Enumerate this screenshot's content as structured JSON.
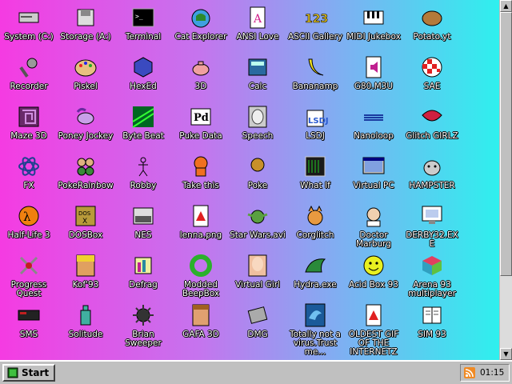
{
  "desktop": {
    "icons": [
      {
        "label": "System (C:)",
        "icon": "computer-icon"
      },
      {
        "label": "Storage (A:)",
        "icon": "floppy-drive-icon"
      },
      {
        "label": "Terminal",
        "icon": "terminal-icon"
      },
      {
        "label": "Cat Explorer",
        "icon": "cat-globe-icon"
      },
      {
        "label": "ANSI Love",
        "icon": "ansi-document-icon"
      },
      {
        "label": "ASCII Gallery",
        "icon": "ascii-numbers-icon"
      },
      {
        "label": "MIDI Jukebox",
        "icon": "piano-keys-icon"
      },
      {
        "label": "Potato.yt",
        "icon": "potato-icon"
      },
      {
        "label": "Recorder",
        "icon": "microphone-icon"
      },
      {
        "label": "Piskel",
        "icon": "palette-icon"
      },
      {
        "label": "HexEd",
        "icon": "hex-cube-icon"
      },
      {
        "label": "3D",
        "icon": "teapot-icon"
      },
      {
        "label": "Calc",
        "icon": "calculator-icon"
      },
      {
        "label": "Bananamp",
        "icon": "banana-icon"
      },
      {
        "label": "G80.M3U",
        "icon": "audio-file-icon"
      },
      {
        "label": "SAE",
        "icon": "checkered-ball-icon"
      },
      {
        "label": "Maze 3D",
        "icon": "maze-icon"
      },
      {
        "label": "Poney Jockey",
        "icon": "pony-icon"
      },
      {
        "label": "Byte Beat",
        "icon": "waveform-icon"
      },
      {
        "label": "Puke Data",
        "icon": "pd-patch-icon"
      },
      {
        "label": "Speech",
        "icon": "face-speech-icon"
      },
      {
        "label": "LSDJ",
        "icon": "lsdj-icon"
      },
      {
        "label": "Nanoloop",
        "icon": "nanoloop-icon"
      },
      {
        "label": "Glitch GIRLZ",
        "icon": "lips-icon"
      },
      {
        "label": "FX",
        "icon": "atom-icon"
      },
      {
        "label": "PokeRainbow",
        "icon": "sprites-icon"
      },
      {
        "label": "Robby",
        "icon": "stick-figure-icon"
      },
      {
        "label": "Take this",
        "icon": "character-icon"
      },
      {
        "label": "Poke",
        "icon": "poke-icon"
      },
      {
        "label": "What If",
        "icon": "terminal-window-icon"
      },
      {
        "label": "Virtual PC",
        "icon": "virtual-pc-icon"
      },
      {
        "label": "HAMPSTER",
        "icon": "hamster-icon"
      },
      {
        "label": "Half-Life 3",
        "icon": "half-life-icon"
      },
      {
        "label": "DOSBox",
        "icon": "dosbox-icon"
      },
      {
        "label": "NES",
        "icon": "nes-console-icon"
      },
      {
        "label": "lenna.png",
        "icon": "image-file-icon"
      },
      {
        "label": "Star Wars.avi",
        "icon": "yoda-icon"
      },
      {
        "label": "Corglitch",
        "icon": "corgi-icon"
      },
      {
        "label": "Doctor Marburg",
        "icon": "doctor-icon"
      },
      {
        "label": "DERBY32.EXE",
        "icon": "derby-monitor-icon"
      },
      {
        "label": "Progress Quest",
        "icon": "crossed-swords-icon"
      },
      {
        "label": "Kof'93",
        "icon": "fighter-portrait-icon"
      },
      {
        "label": "Defrag",
        "icon": "defrag-icon"
      },
      {
        "label": "Modded BeepBox",
        "icon": "green-ring-icon"
      },
      {
        "label": "Virtual Girl",
        "icon": "girl-portrait-icon"
      },
      {
        "label": "Hydra.exe",
        "icon": "dragon-icon"
      },
      {
        "label": "Acid Box 93",
        "icon": "smiley-icon"
      },
      {
        "label": "Arena 93 multiplayer",
        "icon": "cube-icon"
      },
      {
        "label": "SMS",
        "icon": "sms-console-icon"
      },
      {
        "label": "Solitude",
        "icon": "bottle-icon"
      },
      {
        "label": "Brian Sweeper",
        "icon": "mine-icon"
      },
      {
        "label": "GAFA 3D",
        "icon": "face-3d-icon"
      },
      {
        "label": "DMG",
        "icon": "gameboy-icon"
      },
      {
        "label": "Totally not a virus.Trust me...",
        "icon": "dolphin-icon"
      },
      {
        "label": "OLDEST GIF OF THE INTERNETZ",
        "icon": "gif-file-icon"
      },
      {
        "label": "SIM 93",
        "icon": "book-icon"
      }
    ]
  },
  "taskbar": {
    "start_label": "Start",
    "clock": "01:15"
  },
  "scrollbar": {
    "up": "▲",
    "down": "▼"
  }
}
